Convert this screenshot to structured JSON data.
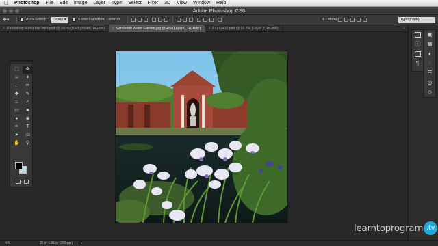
{
  "mac_menu": {
    "items": [
      "Photoshop",
      "File",
      "Edit",
      "Image",
      "Layer",
      "Type",
      "Select",
      "Filter",
      "3D",
      "View",
      "Window",
      "Help"
    ]
  },
  "window": {
    "title": "Adobe Photoshop CS6"
  },
  "options": {
    "auto_select_label": "Auto-Select:",
    "auto_select_value": "Group",
    "show_transform_label": "Show Transform Controls",
    "mode_3d_label": "3D Mode:",
    "workspace": "Typography"
  },
  "tabs": [
    {
      "label": "Photoshop Menu Bar Intro.psd @ 200% (Background, RGB/8)",
      "active": false
    },
    {
      "label": "Vanderbilt Water Garden.jpg @ 4% (Layer 0, RGB/8*)",
      "active": true
    },
    {
      "label": "67171432.psd @ 16.7% (Layer 3, RGB/8)",
      "active": false
    }
  ],
  "tabs_more": "»",
  "status": {
    "zoom": "4%",
    "doc_size": "35 in x 35 in (300 ppi)"
  },
  "colors": {
    "foreground": "#000000",
    "background": "#bfdcf0"
  },
  "toolbox_icons": [
    "move-tool-icon",
    "artboard-icon",
    "marquee-icon",
    "move-tool-icon",
    "lasso-icon",
    "quick-select-icon",
    "crop-icon",
    "eyedropper-icon",
    "healing-brush-icon",
    "brush-icon",
    "clone-stamp-icon",
    "history-brush-icon",
    "eraser-icon",
    "gradient-icon",
    "blur-icon",
    "dodge-icon",
    "pen-icon",
    "type-icon",
    "path-select-icon",
    "shape-icon",
    "hand-icon",
    "zoom-icon"
  ],
  "watermark": {
    "brand": "learntoprogram",
    "suffix": ".tv"
  }
}
